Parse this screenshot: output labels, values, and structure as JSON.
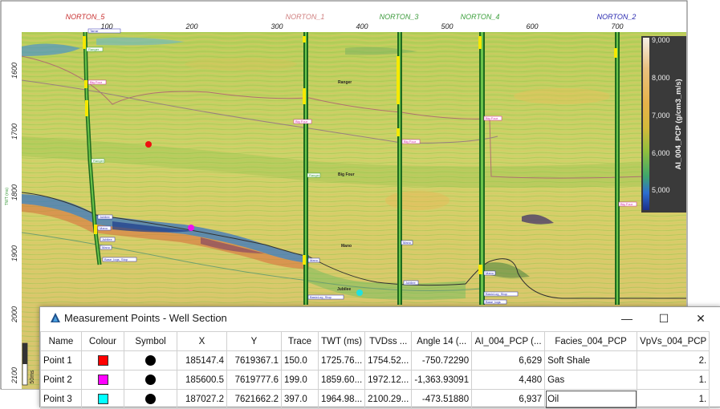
{
  "wells": [
    {
      "name": "NORTON_5",
      "color": "#c83232"
    },
    {
      "name": "NORTON_1",
      "color": "#d08080"
    },
    {
      "name": "NORTON_3",
      "color": "#3c9a3c"
    },
    {
      "name": "NORTON_4",
      "color": "#3ca03c"
    },
    {
      "name": "NORTON_2",
      "color": "#2a2ab0"
    }
  ],
  "trace_ticks": [
    "100",
    "200",
    "300",
    "400",
    "500",
    "600",
    "700"
  ],
  "time_ticks": [
    "1600",
    "1700",
    "1800",
    "1900",
    "2000",
    "2100"
  ],
  "time_axis_label": "TWT (ms)",
  "scale_bar_label": "50ms",
  "horizon_labels": [
    "Ranger",
    "Big Four",
    "Mano",
    "Jubilee"
  ],
  "well_tops": {
    "norton5": [
      "Tarrar",
      "Ranger",
      "Big Four",
      "Ranger",
      "Jubilee",
      "Mano",
      "Jubilee",
      "Mano",
      "Base_logs_Stop"
    ],
    "norton1": [
      "Big Four",
      "Ranger",
      "Mano",
      "BasicLog_Stop"
    ],
    "norton3": [
      "Big Four",
      "Mano",
      "Jubilee"
    ],
    "norton4": [
      "Big Four",
      "Mano",
      "BasicLog_Stop",
      "Base_logs"
    ],
    "norton2": [
      "Big Four"
    ]
  },
  "colorbar": {
    "title": "AI_004_PCP (g/cm3_m/s)",
    "ticks": [
      "9,000",
      "8,000",
      "7,000",
      "6,000",
      "5,000"
    ]
  },
  "dialog": {
    "title": "Measurement Points - Well Section",
    "minimize": "—",
    "maximize": "☐",
    "close": "✕",
    "columns": [
      "Name",
      "Colour",
      "Symbol",
      "X",
      "Y",
      "Trace",
      "TWT (ms)",
      "TVDss ...",
      "Angle  14 (...",
      "AI_004_PCP (...",
      "Facies_004_PCP",
      "VpVs_004_PCP"
    ],
    "rows": [
      {
        "name": "Point 1",
        "colour": "#ff0000",
        "symbol": "filled-circle",
        "x": "185147.4",
        "y": "7619367.1",
        "trace": "150.0",
        "twt": "1725.76...",
        "tvdss": "1754.52...",
        "angle": "-750.72290",
        "ai": "6,629",
        "facies": "Soft Shale",
        "vpvs": "2."
      },
      {
        "name": "Point 2",
        "colour": "#ff00ff",
        "symbol": "filled-circle",
        "x": "185600.5",
        "y": "7619777.6",
        "trace": "199.0",
        "twt": "1859.60...",
        "tvdss": "1972.12...",
        "angle": "-1,363.93091",
        "ai": "4,480",
        "facies": "Gas",
        "vpvs": "1."
      },
      {
        "name": "Point 3",
        "colour": "#00ffff",
        "symbol": "filled-circle",
        "x": "187027.2",
        "y": "7621662.2",
        "trace": "397.0",
        "twt": "1964.98...",
        "tvdss": "2100.29...",
        "angle": "-473.51880",
        "ai": "6,937",
        "facies": "Oil",
        "vpvs": "1."
      }
    ]
  }
}
